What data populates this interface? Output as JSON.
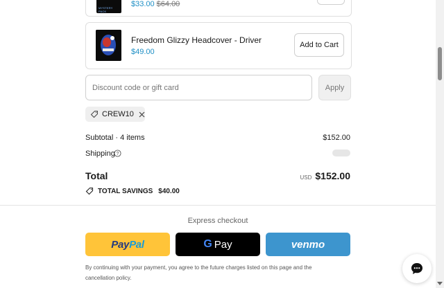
{
  "items": [
    {
      "price": "$33.00",
      "compare_price": "$64.00",
      "thumb_text": "MYSTERY PACK"
    },
    {
      "name": "Freedom Glizzy Headcover - Driver",
      "price": "$49.00",
      "button": "Add to Cart"
    }
  ],
  "discount": {
    "placeholder": "Discount code or gift card",
    "apply_label": "Apply",
    "code": "CREW10"
  },
  "summary": {
    "subtotal_label": "Subtotal · 4 items",
    "subtotal_value": "$152.00",
    "shipping_label": "Shipping",
    "total_label": "Total",
    "currency": "USD",
    "total_value": "$152.00",
    "savings_label": "TOTAL SAVINGS",
    "savings_value": "$40.00"
  },
  "express": {
    "title": "Express checkout",
    "paypal_pay": "Pay",
    "paypal_pal": "Pal",
    "gpay_g": "G",
    "gpay_label": "Pay",
    "venmo_label": "venmo",
    "colors": {
      "paypal": "#ffc439",
      "gpay": "#000000",
      "venmo": "#3d95ce"
    }
  },
  "legal": "By continuing with your payment, you agree to the future charges listed on this page and the cancellation policy.",
  "chat": {
    "icon": "chat-bubble-icon"
  }
}
